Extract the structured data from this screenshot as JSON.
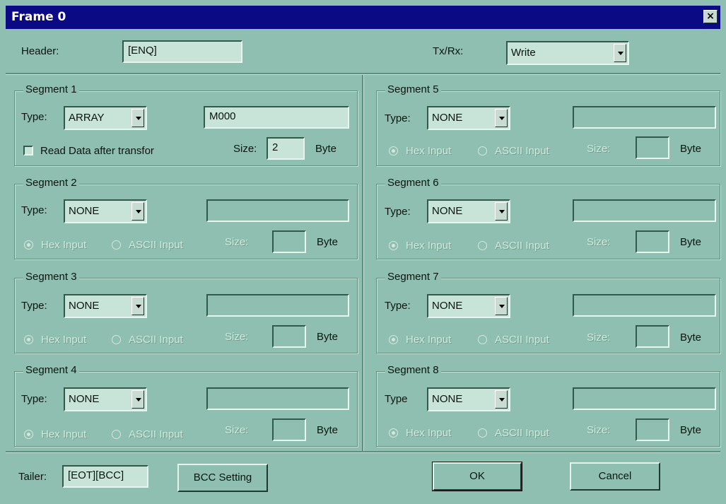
{
  "window": {
    "title": "Frame 0",
    "close_glyph": "×"
  },
  "header": {
    "label": "Header:",
    "value": "[ENQ]"
  },
  "txrx": {
    "label": "Tx/Rx:",
    "value": "Write"
  },
  "segments": [
    {
      "title": "Segment 1",
      "type_label": "Type:",
      "type": "ARRAY",
      "value": "M000",
      "checkbox_label": "Read Data after transfor",
      "size_label": "Size:",
      "size": "2",
      "unit": "Byte"
    },
    {
      "title": "Segment 2",
      "type_label": "Type:",
      "type": "NONE",
      "value": "",
      "hex_label": "Hex Input",
      "ascii_label": "ASCII Input",
      "size_label": "Size:",
      "size": "",
      "unit": "Byte"
    },
    {
      "title": "Segment 3",
      "type_label": "Type:",
      "type": "NONE",
      "value": "",
      "hex_label": "Hex Input",
      "ascii_label": "ASCII Input",
      "size_label": "Size:",
      "size": "",
      "unit": "Byte"
    },
    {
      "title": "Segment 4",
      "type_label": "Type:",
      "type": "NONE",
      "value": "",
      "hex_label": "Hex Input",
      "ascii_label": "ASCII Input",
      "size_label": "Size:",
      "size": "",
      "unit": "Byte"
    },
    {
      "title": "Segment 5",
      "type_label": "Type:",
      "type": "NONE",
      "value": "",
      "hex_label": "Hex Input",
      "ascii_label": "ASCII Input",
      "size_label": "Size:",
      "size": "",
      "unit": "Byte"
    },
    {
      "title": "Segment 6",
      "type_label": "Type:",
      "type": "NONE",
      "value": "",
      "hex_label": "Hex Input",
      "ascii_label": "ASCII Input",
      "size_label": "Size:",
      "size": "",
      "unit": "Byte"
    },
    {
      "title": "Segment 7",
      "type_label": "Type:",
      "type": "NONE",
      "value": "",
      "hex_label": "Hex Input",
      "ascii_label": "ASCII Input",
      "size_label": "Size:",
      "size": "",
      "unit": "Byte"
    },
    {
      "title": "Segment 8",
      "type_label": "Type",
      "type": "NONE",
      "value": "",
      "hex_label": "Hex Input",
      "ascii_label": "ASCII Input",
      "size_label": "Size:",
      "size": "",
      "unit": "Byte"
    }
  ],
  "tailer": {
    "label": "Tailer:",
    "value": "[EOT][BCC]"
  },
  "buttons": {
    "bcc": "BCC Setting",
    "ok": "OK",
    "cancel": "Cancel"
  },
  "colors": {
    "face": "#8fbfb0",
    "title_bar": "#0a0a84",
    "field": "#c8e4d8"
  }
}
